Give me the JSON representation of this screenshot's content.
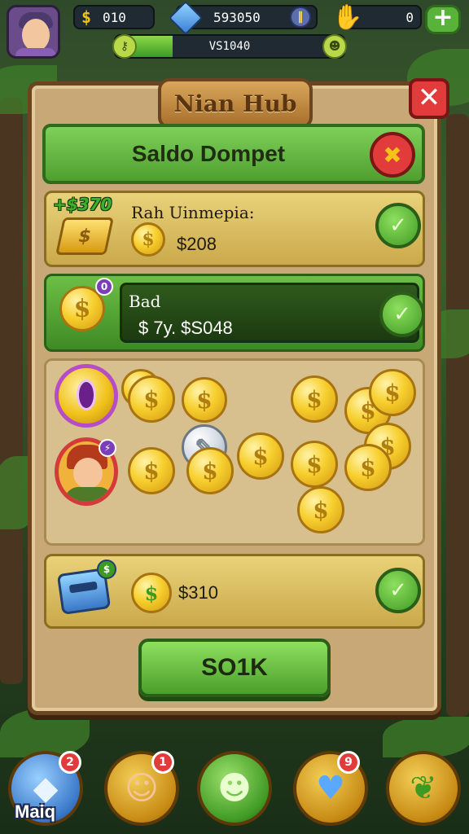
{
  "top_bar": {
    "coins_value": "010",
    "gems_value": "593050",
    "energy_value": "0",
    "xp_text": "VS1040",
    "xp_progress": 0.25
  },
  "panel": {
    "title": "Nian Hub",
    "header": "Saldo Dompet"
  },
  "rows": [
    {
      "tag": "+$370",
      "title": "Rah Uinmepia:",
      "amount": "$208"
    },
    {
      "title": "Bad",
      "amount": "$ 7y. $S048"
    },
    {
      "amount": "$310"
    }
  ],
  "confirm_button": "SO1K",
  "bottom_nav": [
    {
      "label": "Maiq",
      "badge": "2"
    },
    {
      "badge": "1"
    },
    {},
    {
      "badge": "9"
    },
    {}
  ],
  "colors": {
    "primary_green": "#59b33a",
    "panel_wood": "#c9a878",
    "danger_red": "#e23b3b",
    "gold": "#f7cf2e"
  }
}
